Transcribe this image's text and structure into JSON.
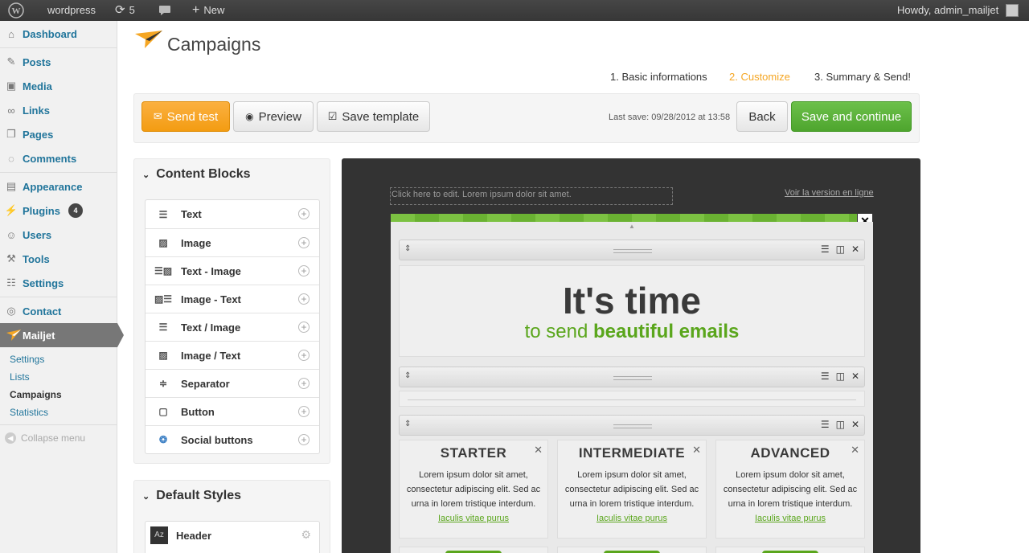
{
  "adminbar": {
    "site": "wordpress",
    "updates": "5",
    "new": "New",
    "howdy": "Howdy, admin_mailjet"
  },
  "menu": {
    "dashboard": "Dashboard",
    "posts": "Posts",
    "media": "Media",
    "links": "Links",
    "pages": "Pages",
    "comments": "Comments",
    "appearance": "Appearance",
    "plugins": "Plugins",
    "plugins_badge": "4",
    "users": "Users",
    "tools": "Tools",
    "settings": "Settings",
    "contact": "Contact",
    "mailjet": "Mailjet",
    "sub_settings": "Settings",
    "sub_lists": "Lists",
    "sub_campaigns": "Campaigns",
    "sub_statistics": "Statistics",
    "collapse": "Collapse menu"
  },
  "page": {
    "title": "Campaigns",
    "step1": "1. Basic informations",
    "step2": "2. Customize",
    "step3": "3. Summary & Send!"
  },
  "toolbar": {
    "send_test": "Send test",
    "preview": "Preview",
    "save_template": "Save template",
    "last_save": "Last save: 09/28/2012 at 13:58",
    "back": "Back",
    "save_continue": "Save and continue"
  },
  "content_blocks": {
    "title": "Content Blocks",
    "items": [
      "Text",
      "Image",
      "Text - Image",
      "Image - Text",
      "Text / Image",
      "Image / Text",
      "Separator",
      "Button",
      "Social buttons"
    ]
  },
  "default_styles": {
    "title": "Default Styles",
    "header": "Header",
    "header_icon": "Az"
  },
  "editor": {
    "placeholder": "Click here to edit. Lorem ipsum dolor sit amet.",
    "online_link": "Voir la version en ligne",
    "headline": "It's time",
    "sub_pre": "to send ",
    "sub_bold": "beautiful emails",
    "columns": [
      {
        "title": "STARTER",
        "text": "Lorem ipsum dolor sit amet, consectetur adipiscing elit. Sed ac urna in lorem tristique interdum.",
        "link": "Iaculis vitae purus"
      },
      {
        "title": "INTERMEDIATE",
        "text": "Lorem ipsum dolor sit amet, consectetur adipiscing elit. Sed ac urna in lorem tristique interdum.",
        "link": "Iaculis vitae purus"
      },
      {
        "title": "ADVANCED",
        "text": "Lorem ipsum dolor sit amet, consectetur adipiscing elit. Sed ac urna in lorem tristique interdum.",
        "link": "Iaculis vitae purus"
      }
    ]
  },
  "colors": {
    "orange": "#f5a623",
    "green": "#5cb030",
    "wp_link": "#21759b",
    "dark_canvas": "#333333"
  }
}
